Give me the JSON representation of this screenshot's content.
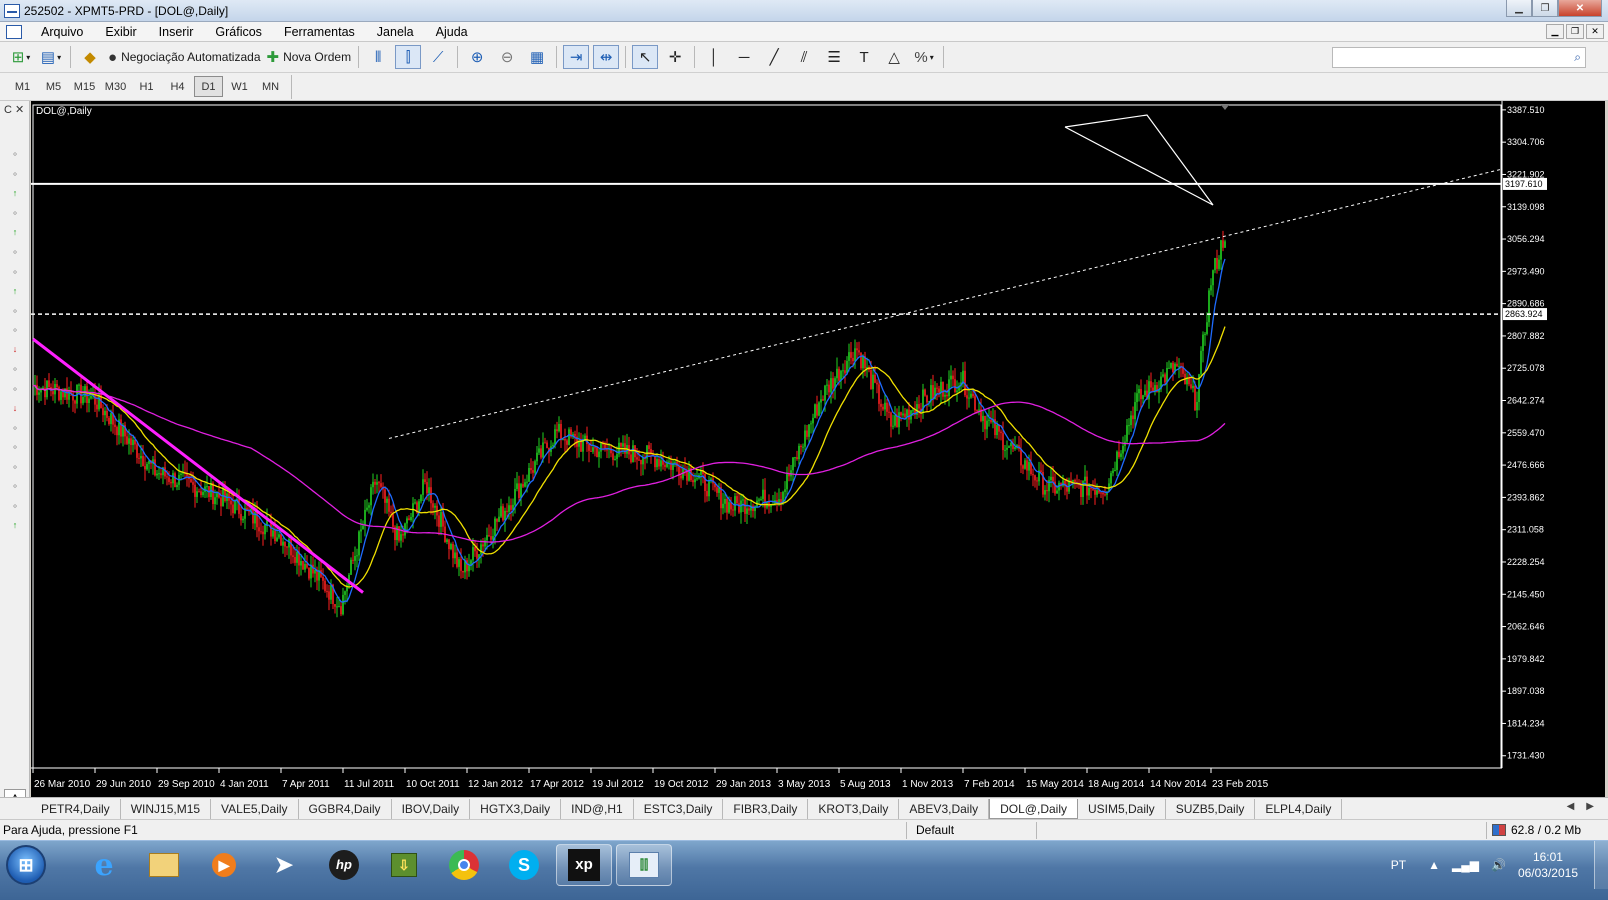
{
  "window": {
    "title": "252502 - XPMT5-PRD - [DOL@,Daily]"
  },
  "menu": {
    "items": [
      "Arquivo",
      "Exibir",
      "Inserir",
      "Gráficos",
      "Ferramentas",
      "Janela",
      "Ajuda"
    ]
  },
  "toolbar": {
    "auto_trading_label": "Negociação Automatizada",
    "new_order_label": "Nova Ordem",
    "search_placeholder": ""
  },
  "timeframes": {
    "items": [
      "M1",
      "M5",
      "M15",
      "M30",
      "H1",
      "H4",
      "D1",
      "W1",
      "MN"
    ],
    "active": "D1"
  },
  "left_panel": {
    "header": "C ✕",
    "footer": "A"
  },
  "chart_data": {
    "type": "candlestick",
    "title": "DOL@,Daily",
    "symbol": "DOL@",
    "timeframe": "Daily",
    "ylim": [
      1700,
      3400
    ],
    "y_ticks": [
      "3387.510",
      "3304.706",
      "3221.902",
      "3139.098",
      "3056.294",
      "2973.490",
      "2890.686",
      "2807.882",
      "2725.078",
      "2642.274",
      "2559.470",
      "2476.666",
      "2393.862",
      "2311.058",
      "2228.254",
      "2145.450",
      "2062.646",
      "1979.842",
      "1897.038",
      "1814.234",
      "1731.430"
    ],
    "x_ticks": [
      "26 Mar 2010",
      "29 Jun 2010",
      "29 Sep 2010",
      "4 Jan 2011",
      "7 Apr 2011",
      "11 Jul 2011",
      "10 Oct 2011",
      "12 Jan 2012",
      "17 Apr 2012",
      "19 Jul 2012",
      "19 Oct 2012",
      "29 Jan 2013",
      "3 May 2013",
      "5 Aug 2013",
      "1 Nov 2013",
      "7 Feb 2014",
      "15 May 2014",
      "18 Aug 2014",
      "14 Nov 2014",
      "23 Feb 2015"
    ],
    "price_labels": {
      "upper_line": "3197.610",
      "lower_line": "2863.924"
    },
    "close_path": [
      [
        "26 Mar 2010",
        2680
      ],
      [
        "29 Jun 2010",
        2650
      ],
      [
        "29 Sep 2010",
        2460
      ],
      [
        "4 Jan 2011",
        2400
      ],
      [
        "7 Apr 2011",
        2300
      ],
      [
        "11 Jul 2011",
        2120
      ],
      [
        "Sep 2011",
        2440
      ],
      [
        "10 Oct 2011",
        2280
      ],
      [
        "Nov 2011",
        2430
      ],
      [
        "12 Jan 2012",
        2200
      ],
      [
        "Feb 2012",
        2330
      ],
      [
        "17 Apr 2012",
        2560
      ],
      [
        "19 Jul 2012",
        2520
      ],
      [
        "19 Oct 2012",
        2500
      ],
      [
        "Dec 2012",
        2460
      ],
      [
        "29 Jan 2013",
        2370
      ],
      [
        "3 May 2013",
        2400
      ],
      [
        "Jun 2013",
        2650
      ],
      [
        "5 Aug 2013",
        2780
      ],
      [
        "Sep 2013",
        2580
      ],
      [
        "1 Nov 2013",
        2650
      ],
      [
        "Jan 2014",
        2700
      ],
      [
        "7 Feb 2014",
        2590
      ],
      [
        "15 May 2014",
        2420
      ],
      [
        "18 Aug 2014",
        2420
      ],
      [
        "Oct 2014",
        2640
      ],
      [
        "14 Nov 2014",
        2730
      ],
      [
        "Jan 2015",
        2640
      ],
      [
        "23 Feb 2015",
        2950
      ],
      [
        "Mar 2015",
        3080
      ]
    ],
    "indicator_lines": [
      {
        "name": "ma-fast",
        "color": "#1e6bff"
      },
      {
        "name": "ma-mid",
        "color": "#f0e000"
      },
      {
        "name": "ma-slow",
        "color": "#e020e0"
      }
    ],
    "grid": false
  },
  "tabs": {
    "items": [
      "PETR4,Daily",
      "WINJ15,M15",
      "VALE5,Daily",
      "GGBR4,Daily",
      "IBOV,Daily",
      "HGTX3,Daily",
      "IND@,H1",
      "ESTC3,Daily",
      "FIBR3,Daily",
      "KROT3,Daily",
      "ABEV3,Daily",
      "DOL@,Daily",
      "USIM5,Daily",
      "SUZB5,Daily",
      "ELPL4,Daily"
    ],
    "active": "DOL@,Daily"
  },
  "status": {
    "help": "Para Ajuda, pressione F1",
    "profile": "Default",
    "net": "62.8 / 0.2 Mb"
  },
  "taskbar": {
    "lang": "PT",
    "time": "16:01",
    "date": "06/03/2015"
  }
}
